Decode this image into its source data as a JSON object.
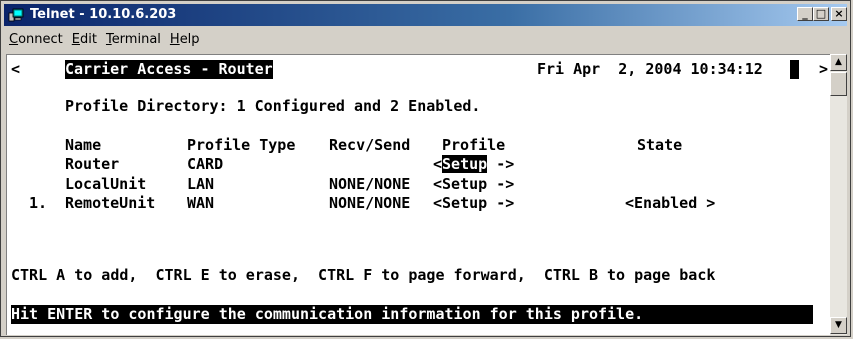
{
  "window": {
    "title": "Telnet - 10.10.6.203",
    "minimize_glyph": "_",
    "maximize_glyph": "□",
    "close_glyph": "×"
  },
  "menu": {
    "connect": {
      "u": "C",
      "rest": "onnect"
    },
    "edit": {
      "u": "E",
      "rest": "dit"
    },
    "terminal": {
      "u": "T",
      "rest": "erminal"
    },
    "help": {
      "u": "H",
      "rest": "elp"
    }
  },
  "screen": {
    "scroll_left_marker": "<",
    "scroll_right_marker": ">",
    "app_title": "Carrier Access - Router",
    "datetime": "Fri Apr  2, 2004 10:34:12",
    "directory_line": "Profile Directory: 1 Configured and 2 Enabled.",
    "columns": {
      "name": "Name",
      "profile_type": "Profile Type",
      "recv_send": "Recv/Send",
      "profile": "Profile",
      "state": "State"
    },
    "rows": [
      {
        "index": "",
        "name": "Router",
        "type": "CARD",
        "recv_send": "",
        "profile_prefix": "<",
        "profile_action": "Setup",
        "profile_suffix": " ->",
        "state": ""
      },
      {
        "index": "",
        "name": "LocalUnit",
        "type": "LAN",
        "recv_send": "NONE/NONE",
        "profile_prefix": "<",
        "profile_action": "Setup",
        "profile_suffix": " ->",
        "state": ""
      },
      {
        "index": "1.",
        "name": "RemoteUnit",
        "type": "WAN",
        "recv_send": "NONE/NONE",
        "profile_prefix": "<",
        "profile_action": "Setup",
        "profile_suffix": " ->",
        "state": "<Enabled >"
      }
    ],
    "help_line": "CTRL A to add,  CTRL E to erase,  CTRL F to page forward,  CTRL B to page back",
    "status_line": "Hit ENTER to configure the communication information for this profile."
  },
  "scrollbar": {
    "up_glyph": "▲",
    "down_glyph": "▼"
  },
  "colors": {
    "title_start": "#0a246a",
    "title_end": "#a6caf0",
    "terminal_bg": "#ffffff",
    "terminal_fg": "#000000"
  }
}
